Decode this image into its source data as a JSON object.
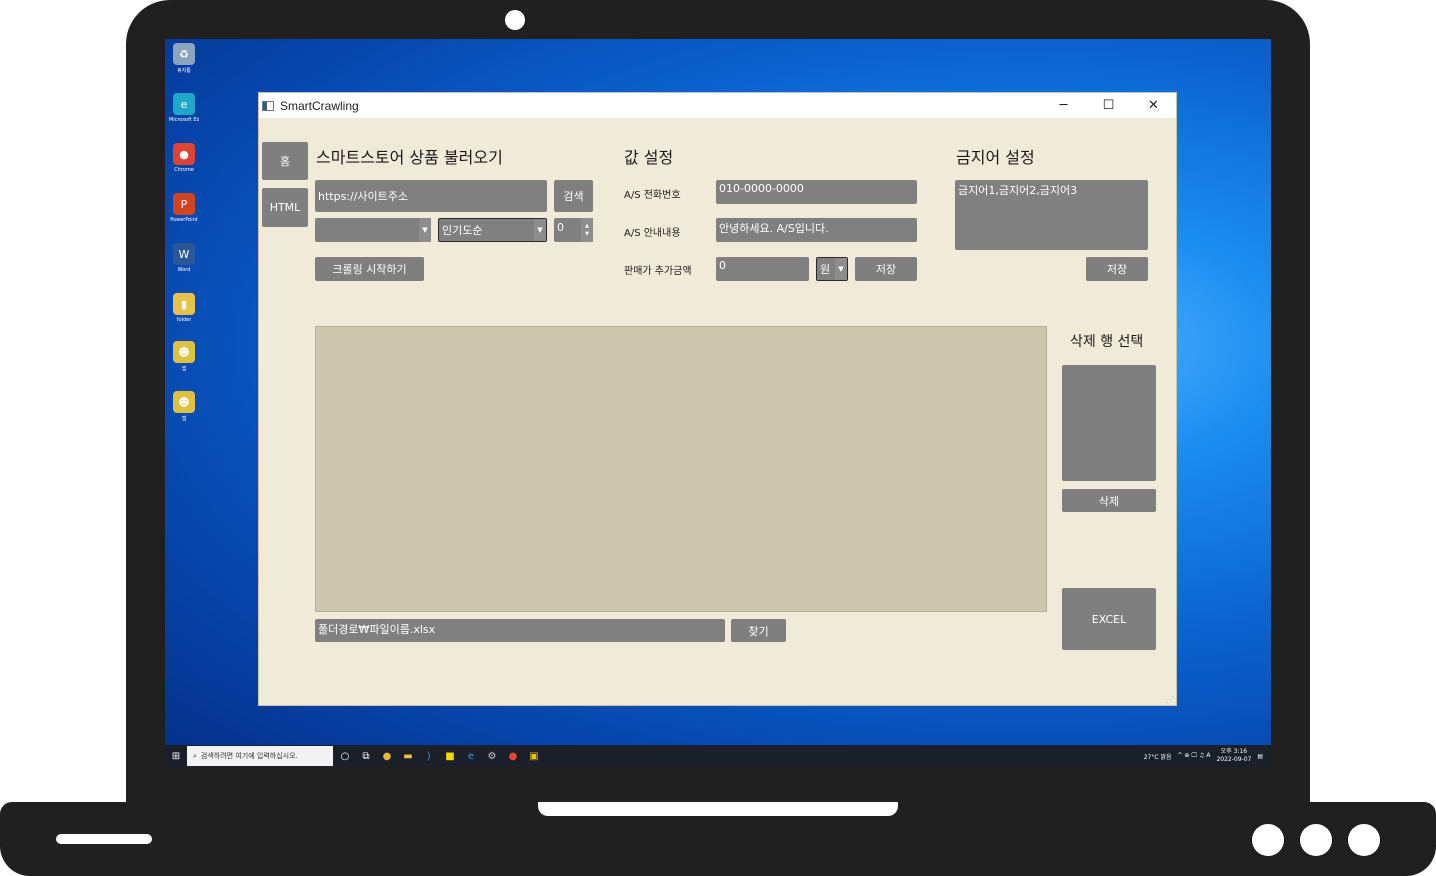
{
  "desktop": {
    "icons": [
      {
        "name": "recycle-bin-icon",
        "label": "휴지통",
        "glyph": "♻",
        "bg": "#8aa4c0"
      },
      {
        "name": "edge-icon",
        "label": "Microsoft Edge",
        "glyph": "e",
        "bg": "#1fa6c8"
      },
      {
        "name": "chrome-icon",
        "label": "Chrome",
        "glyph": "●",
        "bg": "#db4437"
      },
      {
        "name": "powerpoint-icon",
        "label": "PowerPoint",
        "glyph": "P",
        "bg": "#d04423"
      },
      {
        "name": "word-icon",
        "label": "Word",
        "glyph": "W",
        "bg": "#2b5797"
      },
      {
        "name": "folder-icon",
        "label": "folder",
        "glyph": "▮",
        "bg": "#e8c24a"
      },
      {
        "name": "app-icon-1",
        "label": "앱",
        "glyph": "☻",
        "bg": "#e0c040"
      },
      {
        "name": "app-icon-2",
        "label": "앱",
        "glyph": "☻",
        "bg": "#e0c040"
      }
    ]
  },
  "taskbar": {
    "search_placeholder": "검색하려면 여기에 입력하십시오.",
    "weather": "27°C 맑음",
    "tray": "^ ⊕ 🖵 ♫ A",
    "time": "오후 3:16",
    "date": "2022-09-07"
  },
  "window": {
    "title": "SmartCrawling",
    "minimize": "─",
    "maximize": "☐",
    "close": "✕"
  },
  "sidebar": {
    "home": "홈",
    "html": "HTML"
  },
  "store": {
    "heading": "스마트스토어 상품 불러오기",
    "url_value": "https://사이트주소",
    "search_button": "검색",
    "category_value": "",
    "sort_value": "인기도순",
    "count_value": "0",
    "start_button": "크롤링 시작하기"
  },
  "values": {
    "heading": "값 설정",
    "phone_label": "A/S 전화번호",
    "phone_value": "010-0000-0000",
    "info_label": "A/S 안내내용",
    "info_value": "안녕하세요. A/S입니다.",
    "price_label": "판매가 추가금액",
    "price_value": "0",
    "unit_value": "원",
    "save_button": "저장"
  },
  "banned": {
    "heading": "금지어 설정",
    "words_value": "금지어1,금지어2,금지어3",
    "save_button": "저장"
  },
  "delete_panel": {
    "heading": "삭제 행 선택",
    "delete_button": "삭제",
    "excel_button": "EXCEL"
  },
  "file": {
    "path_value": "폴더경로₩파일이름.xlsx",
    "find_button": "찾기"
  },
  "colors": {
    "window_bg": "#f0ead8",
    "control_gray": "#808080",
    "grid_bg": "#cdc7b0"
  }
}
